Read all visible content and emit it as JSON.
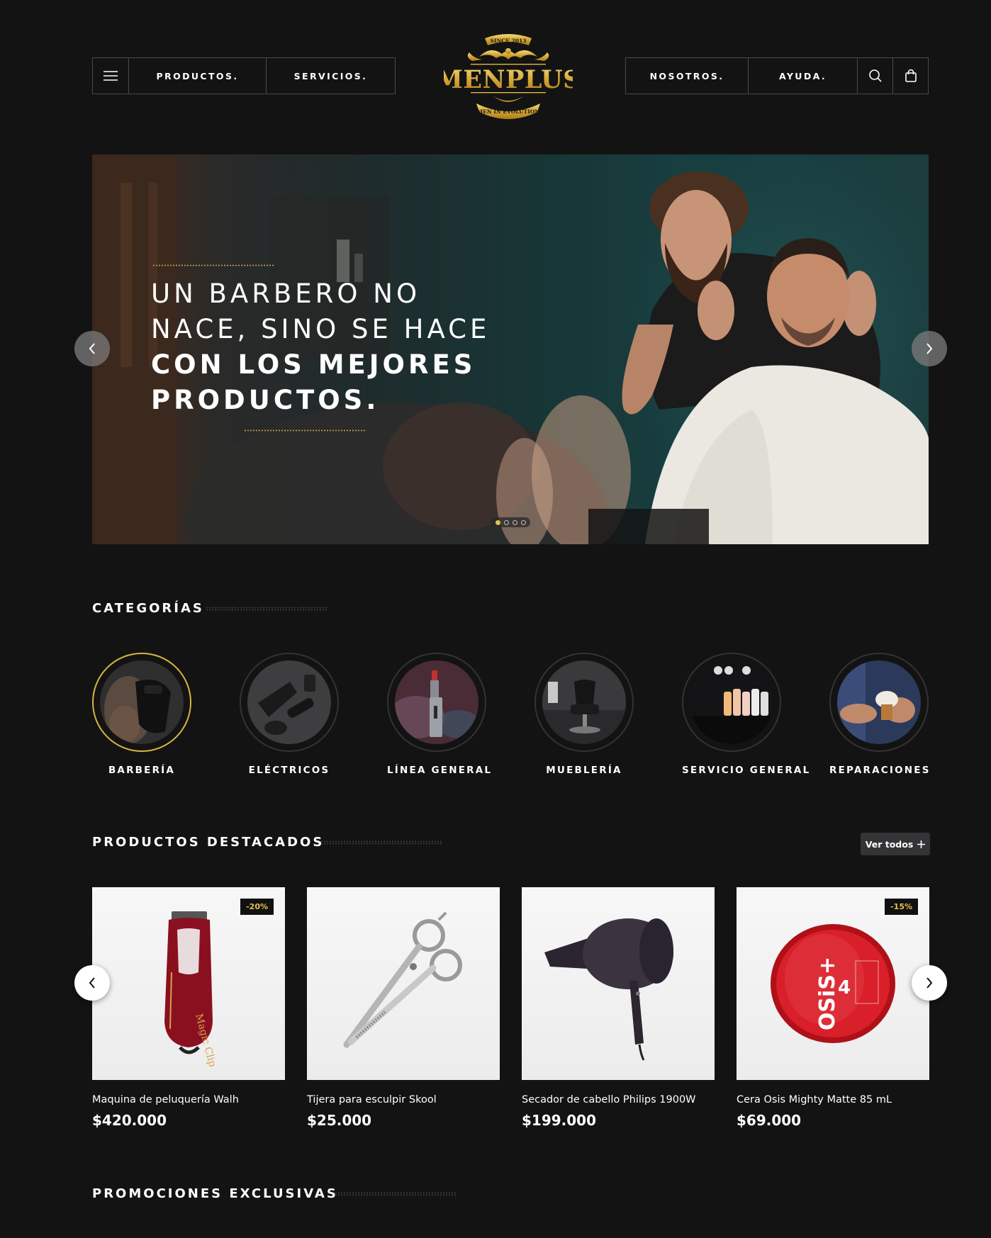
{
  "header": {
    "nav_left": [
      "PRODUCTOS.",
      "SERVICIOS."
    ],
    "nav_right": [
      "NOSOTROS.",
      "AYUDA."
    ],
    "logo": {
      "brand": "MENPLUS",
      "since": "SINCE 2013",
      "tagline": "MEN IN EVOLUTION"
    },
    "icons": [
      "menu-icon",
      "search-icon",
      "shopping-bag-icon"
    ]
  },
  "hero": {
    "line1": "UN BARBERO NO",
    "line2": "NACE, SINO SE HACE",
    "line3": "CON LOS MEJORES",
    "line4": "PRODUCTOS.",
    "slides_total": 4,
    "active_slide": 1
  },
  "categories": {
    "title": "CATEGORÍAS",
    "items": [
      {
        "label": "BARBERÍA",
        "active": true
      },
      {
        "label": "ELÉCTRICOS",
        "active": false
      },
      {
        "label": "LÍNEA GENERAL",
        "active": false
      },
      {
        "label": "MUEBLERÍA",
        "active": false
      },
      {
        "label": "SERVICIO GENERAL",
        "active": false
      },
      {
        "label": "REPARACIONES",
        "active": false
      }
    ]
  },
  "featured": {
    "title": "PRODUCTOS DESTACADOS",
    "view_all": "Ver todos",
    "products": [
      {
        "name": "Maquina de peluquería Walh",
        "price": "$420.000",
        "badge": "-20%"
      },
      {
        "name": "Tijera para esculpir Skool",
        "price": "$25.000",
        "badge": ""
      },
      {
        "name": "Secador de cabello Philips 1900W",
        "price": "$199.000",
        "badge": ""
      },
      {
        "name": "Cera Osis Mighty Matte 85 mL",
        "price": "$69.000",
        "badge": "-15%"
      }
    ]
  },
  "promotions": {
    "title": "PROMOCIONES EXCLUSIVAS"
  },
  "colors": {
    "background": "#131314",
    "accent_gold": "#e3c04f",
    "border": "#4a4a4c"
  }
}
